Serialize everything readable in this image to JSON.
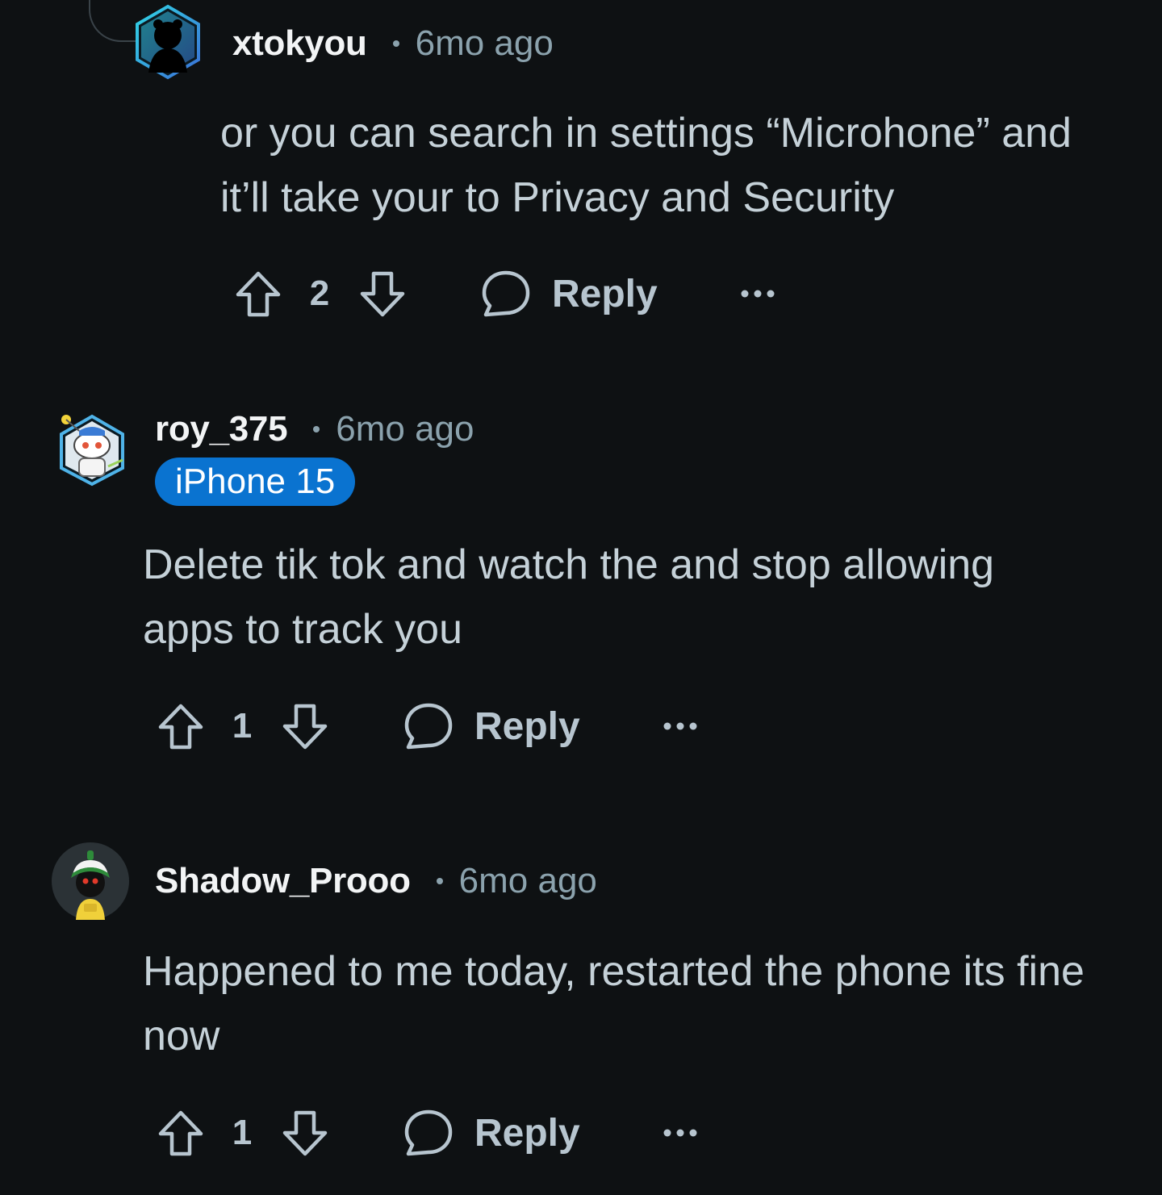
{
  "comments": [
    {
      "username": "xtokyou",
      "time": "6mo ago",
      "flair": null,
      "body": "or you can search in settings “Microhone” and it’ll take your to Privacy and Security",
      "score": "2",
      "reply_label": "Reply",
      "avatar": "xtokyou-avatar"
    },
    {
      "username": "roy_375",
      "time": "6mo ago",
      "flair": "iPhone 15",
      "body": "Delete tik tok and watch the and stop allowing apps to track you",
      "score": "1",
      "reply_label": "Reply",
      "avatar": "roy-avatar"
    },
    {
      "username": "Shadow_Prooo",
      "time": "6mo ago",
      "flair": null,
      "body": "Happened to me today, restarted the phone its fine now",
      "score": "1",
      "reply_label": "Reply",
      "avatar": "shadow-avatar"
    }
  ],
  "colors": {
    "background": "#0e1113",
    "username": "#f2f4f5",
    "meta": "#8ba2ad",
    "body": "#c5d1d8",
    "flair_bg": "#0a73d0"
  },
  "icons": [
    "upvote-icon",
    "downvote-icon",
    "comment-bubble-icon",
    "more-options-icon"
  ]
}
